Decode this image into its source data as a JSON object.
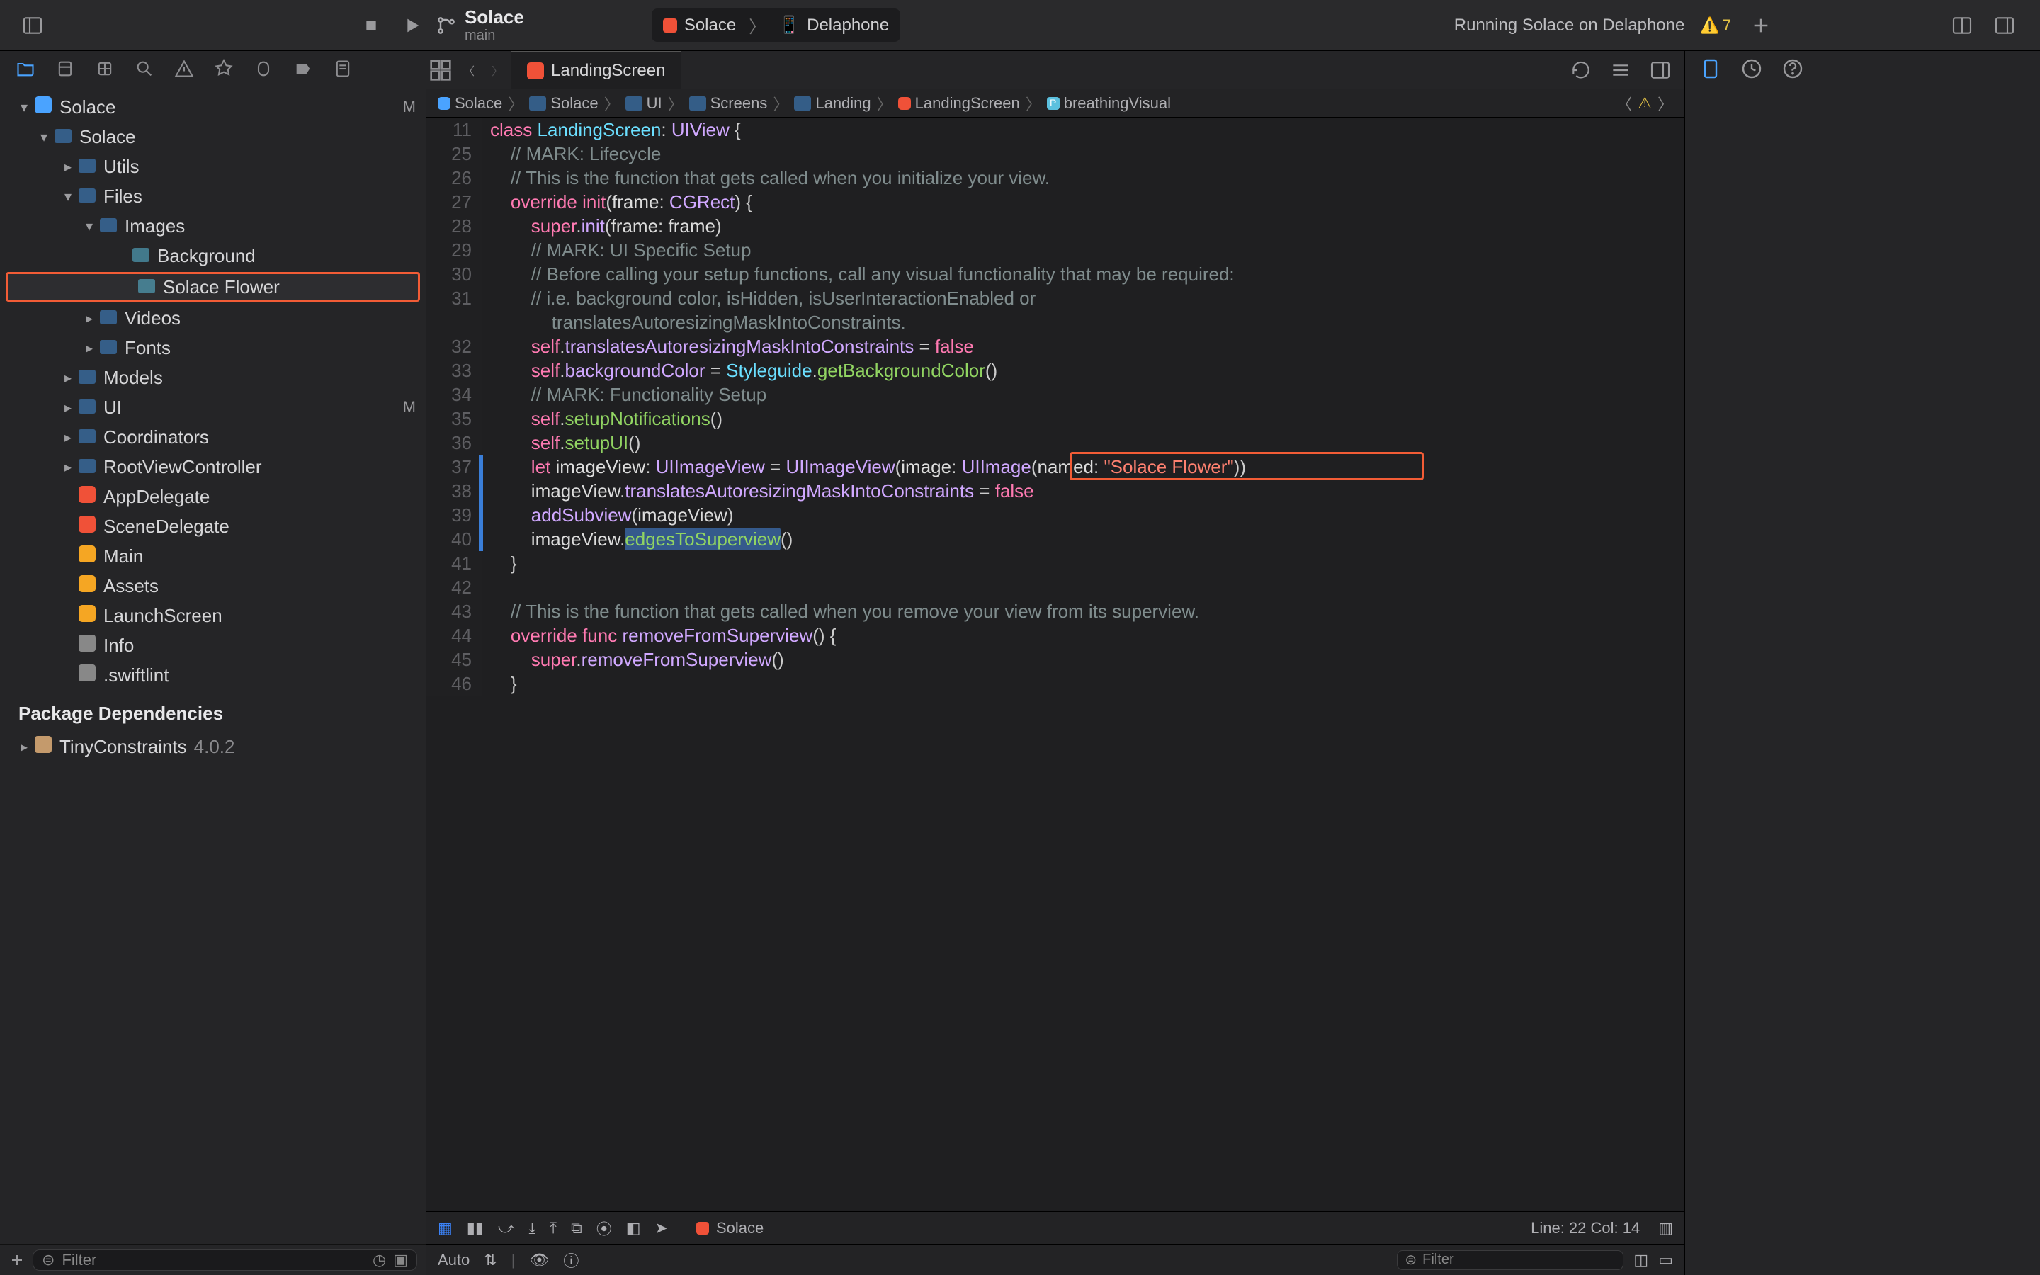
{
  "project": {
    "name": "Solace",
    "branch": "main"
  },
  "scheme": {
    "target": "Solace",
    "device": "Delaphone"
  },
  "run_status": "Running Solace on Delaphone",
  "warning_count": "7",
  "navigator": {
    "root": "Solace",
    "root_badge": "M",
    "items": [
      {
        "label": "Solace",
        "depth": 1,
        "kind": "folder",
        "open": true
      },
      {
        "label": "Utils",
        "depth": 2,
        "kind": "folder",
        "closed": true
      },
      {
        "label": "Files",
        "depth": 2,
        "kind": "folder",
        "open": true
      },
      {
        "label": "Images",
        "depth": 3,
        "kind": "folder",
        "open": true
      },
      {
        "label": "Background",
        "depth": 4,
        "kind": "image"
      },
      {
        "label": "Solace Flower",
        "depth": 4,
        "kind": "image",
        "highlight": true
      },
      {
        "label": "Videos",
        "depth": 3,
        "kind": "folder",
        "closed": true
      },
      {
        "label": "Fonts",
        "depth": 3,
        "kind": "folder",
        "closed": true
      },
      {
        "label": "Models",
        "depth": 2,
        "kind": "folder",
        "closed": true
      },
      {
        "label": "UI",
        "depth": 2,
        "kind": "folder",
        "closed": true,
        "badge": "M"
      },
      {
        "label": "Coordinators",
        "depth": 2,
        "kind": "folder",
        "closed": true
      },
      {
        "label": "RootViewController",
        "depth": 2,
        "kind": "folder",
        "closed": true
      },
      {
        "label": "AppDelegate",
        "depth": 2,
        "kind": "swift"
      },
      {
        "label": "SceneDelegate",
        "depth": 2,
        "kind": "swift"
      },
      {
        "label": "Main",
        "depth": 2,
        "kind": "asset"
      },
      {
        "label": "Assets",
        "depth": 2,
        "kind": "asset"
      },
      {
        "label": "LaunchScreen",
        "depth": 2,
        "kind": "asset"
      },
      {
        "label": "Info",
        "depth": 2,
        "kind": "plist"
      },
      {
        "label": ".swiftlint",
        "depth": 2,
        "kind": "plist"
      }
    ],
    "section_packages": "Package Dependencies",
    "packages": [
      {
        "name": "TinyConstraints",
        "version": "4.0.2"
      }
    ],
    "filter_placeholder": "Filter"
  },
  "tabs": {
    "active": "LandingScreen"
  },
  "breadcrumb": [
    "Solace",
    "Solace",
    "UI",
    "Screens",
    "Landing",
    "LandingScreen",
    "breathingVisual"
  ],
  "code": {
    "first_line_number": 11,
    "start_offset": 0,
    "lines": [
      {
        "raw": "class LandingScreen: UIView {",
        "html": "<span class='k-keyword'>class</span> <span class='k-type'>LandingScreen</span>: <span class='k-ext'>UIView</span> {"
      },
      {
        "raw": "    // MARK: Lifecycle",
        "html": "    <span class='k-comment'>// MARK: Lifecycle</span>"
      },
      {
        "raw": "    // This is the function that gets called when you initialize your view.",
        "html": "    <span class='k-comment'>// This is the function that gets called when you initialize your view.</span>"
      },
      {
        "raw": "    override init(frame: CGRect) {",
        "html": "    <span class='k-keyword'>override</span> <span class='k-keyword'>init</span>(<span class='k-id'>frame</span>: <span class='k-ext'>CGRect</span>) {"
      },
      {
        "raw": "        super.init(frame: frame)",
        "html": "        <span class='k-keyword'>super</span>.<span class='k-ext'>init</span>(<span class='k-id'>frame</span>: <span class='k-id'>frame</span>)"
      },
      {
        "raw": "        // MARK: UI Specific Setup",
        "html": "        <span class='k-comment'>// MARK: UI Specific Setup</span>"
      },
      {
        "raw": "        // Before calling your setup functions, call any visual functionality that may be required:",
        "html": "        <span class='k-comment'>// Before calling your setup functions, call any visual functionality that may be required:</span>"
      },
      {
        "raw": "        // i.e. background color, isHidden, isUserInteractionEnabled or",
        "html": "        <span class='k-comment'>// i.e. background color, isHidden, isUserInteractionEnabled or</span>"
      },
      {
        "raw": "            translatesAutoresizingMaskIntoConstraints.",
        "html": "            <span class='k-comment'>translatesAutoresizingMaskIntoConstraints.</span>"
      },
      {
        "raw": "        self.translatesAutoresizingMaskIntoConstraints = false",
        "html": "        <span class='k-keyword'>self</span>.<span class='k-ext'>translatesAutoresizingMaskIntoConstraints</span> = <span class='k-bool'>false</span>"
      },
      {
        "raw": "        self.backgroundColor = Styleguide.getBackgroundColor()",
        "html": "        <span class='k-keyword'>self</span>.<span class='k-ext'>backgroundColor</span> = <span class='k-type'>Styleguide</span>.<span class='k-prop'>getBackgroundColor</span>()"
      },
      {
        "raw": "        // MARK: Functionality Setup",
        "html": "        <span class='k-comment'>// MARK: Functionality Setup</span>"
      },
      {
        "raw": "        self.setupNotifications()",
        "html": "        <span class='k-keyword'>self</span>.<span class='k-prop'>setupNotifications</span>()"
      },
      {
        "raw": "        self.setupUI()",
        "html": "        <span class='k-keyword'>self</span>.<span class='k-prop'>setupUI</span>()"
      },
      {
        "raw": "        let imageView: UIImageView = UIImageView(image: UIImage(named: \"Solace Flower\"))",
        "html": "        <span class='k-keyword'>let</span> <span class='k-id'>imageView</span>: <span class='k-ext'>UIImageView</span> = <span class='k-ext'>UIImageView</span>(<span class='k-id'>image</span>: <span class='k-ext'>UIImage</span>(<span class='k-id'>named</span>: <span class='k-string'>\"Solace Flower\"</span>))",
        "changed": true,
        "spotlight": true
      },
      {
        "raw": "        imageView.translatesAutoresizingMaskIntoConstraints = false",
        "html": "        <span class='k-id'>imageView</span>.<span class='k-ext'>translatesAutoresizingMaskIntoConstraints</span> = <span class='k-bool'>false</span>",
        "changed": true
      },
      {
        "raw": "        addSubview(imageView)",
        "html": "        <span class='k-ext'>addSubview</span>(<span class='k-id'>imageView</span>)",
        "changed": true
      },
      {
        "raw": "        imageView.edgesToSuperview()",
        "html": "        <span class='k-id'>imageView</span>.<span class='sel-span'><span class='k-prop'>edgesToSuperview</span></span>()",
        "changed": true
      },
      {
        "raw": "    }",
        "html": "    }"
      },
      {
        "raw": "",
        "html": ""
      },
      {
        "raw": "    // This is the function that gets called when you remove your view from its superview.",
        "html": "    <span class='k-comment'>// This is the function that gets called when you remove your view from its superview.</span>"
      },
      {
        "raw": "    override func removeFromSuperview() {",
        "html": "    <span class='k-keyword'>override</span> <span class='k-keyword'>func</span> <span class='k-ext'>removeFromSuperview</span>() {"
      },
      {
        "raw": "        super.removeFromSuperview()",
        "html": "        <span class='k-keyword'>super</span>.<span class='k-ext'>removeFromSuperview</span>()"
      },
      {
        "raw": "    }",
        "html": "    }"
      }
    ]
  },
  "debug": {
    "auto": "Auto",
    "target": "Solace",
    "cursor": "Line: 22  Col: 14",
    "filter_placeholder": "Filter"
  }
}
